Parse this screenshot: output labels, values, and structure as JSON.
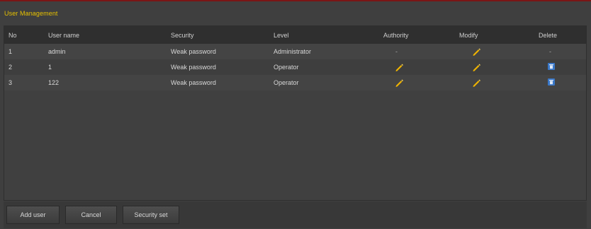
{
  "window": {
    "title": "User Management"
  },
  "table": {
    "columns": {
      "no": "No",
      "user_name": "User name",
      "security": "Security",
      "level": "Level",
      "authority": "Authority",
      "modify": "Modify",
      "delete": "Delete"
    },
    "rows": [
      {
        "no": "1",
        "user_name": "admin",
        "security": "Weak password",
        "level": "Administrator",
        "authority": "-",
        "modify": "pencil-icon",
        "delete": "-"
      },
      {
        "no": "2",
        "user_name": "1",
        "security": "Weak password",
        "level": "Operator",
        "authority": "pencil-icon",
        "modify": "pencil-icon",
        "delete": "trash-icon"
      },
      {
        "no": "3",
        "user_name": "122",
        "security": "Weak password",
        "level": "Operator",
        "authority": "pencil-icon",
        "modify": "pencil-icon",
        "delete": "trash-icon"
      }
    ]
  },
  "buttons": {
    "add_user": "Add user",
    "cancel": "Cancel",
    "security_set": "Security set"
  },
  "colors": {
    "title": "#e6c000",
    "edit_icon": "#f0b400",
    "delete_icon": "#3a78c8",
    "top_border": "#7a1515"
  }
}
